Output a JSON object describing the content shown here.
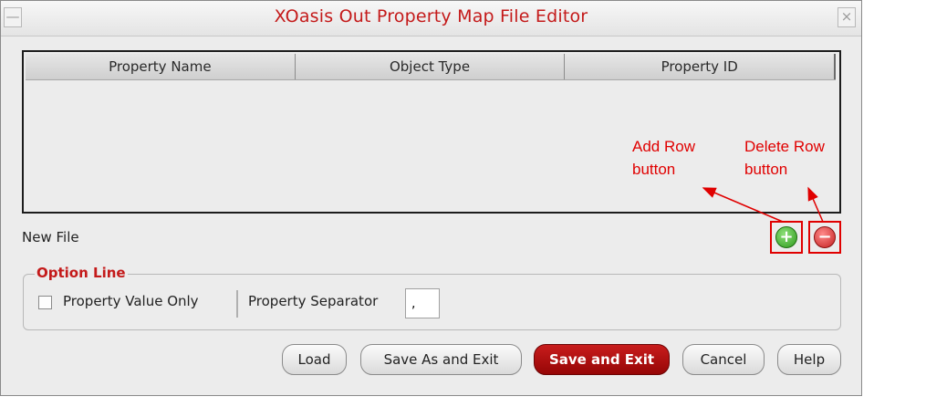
{
  "window": {
    "title": "XOasis Out Property Map File Editor",
    "minimize_glyph": "—",
    "close_glyph": "×"
  },
  "table": {
    "columns": [
      "Property Name",
      "Object Type",
      "Property ID"
    ],
    "rows": []
  },
  "status": "New File",
  "row_buttons": {
    "add_icon": "add-circle-icon",
    "delete_icon": "delete-circle-icon",
    "add_glyph": "+",
    "delete_glyph": "−"
  },
  "annotations": {
    "add_line1": "Add  Row",
    "add_line2": "button",
    "delete_line1": "Delete Row",
    "delete_line2": "button",
    "color": "#e00000"
  },
  "option_line": {
    "legend": "Option Line",
    "checkbox_label": "Property Value Only",
    "checkbox_checked": false,
    "separator_label": "Property Separator",
    "separator_value": ","
  },
  "buttons": {
    "load": "Load",
    "save_as_exit": "Save As and Exit",
    "save_exit": "Save and Exit",
    "cancel": "Cancel",
    "help": "Help"
  },
  "colors": {
    "title": "#c41a1a",
    "primary_button": "#b01010",
    "highlight_box": "#e00000"
  }
}
